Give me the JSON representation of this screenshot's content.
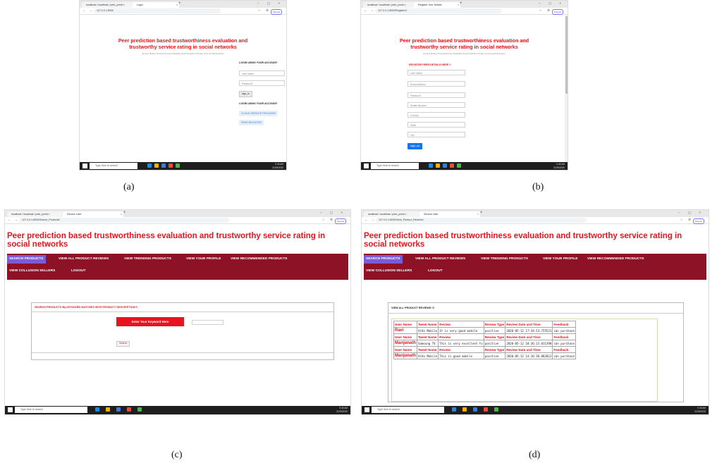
{
  "captions": {
    "a": "(a)",
    "b": "(b)",
    "c": "(c)",
    "d": "(d)"
  },
  "chrome": {
    "tab_localhost": "localhost / localhost / peer_predi ×",
    "tab_login": "Login",
    "tab_register": "Register Your Details",
    "tab_service_user": "Service User",
    "new_tab": "+",
    "window_controls": "– ▢ ×",
    "nav_buttons": "← → C",
    "url_a": "127.0.0.1:8000",
    "url_b": "127.0.0.1:8000/Register1/",
    "url_c": "127.0.0.1:8000/Search_Products/",
    "url_d": "127.0.0.1:8000/View_Product_Reviews/",
    "paused": "Paused"
  },
  "taskbar": {
    "search_placeholder": "Type here to search",
    "time": "9:45 AM",
    "date": "21/05/2020",
    "lang": "ENG IN"
  },
  "app": {
    "title": "Peer prediction based trustworthiness evaluation and trustworthy service rating in social networks",
    "subtitle": "Service Rating Trustworthiness Reliability Peer Prediction Private Trust Social Networks"
  },
  "login": {
    "heading_user": "LOGIN USING YOUR ACCOUNT:",
    "username_placeholder": "User Name",
    "password_placeholder": "Password",
    "signin": "sign_in",
    "heading_other": "LOGIN USING YOUR ACCOUNT:",
    "cloud_button": "CLOUD SERVICE PROVIDER",
    "peer_button": "PEER REGISTER"
  },
  "register": {
    "heading": "REGISTER PEER DETAILS HERE !!",
    "fields": [
      "User Name",
      "Email Address",
      "Password",
      "Mobile Number",
      "Country",
      "State",
      "City"
    ],
    "signup": "sign_up"
  },
  "menu": {
    "items": [
      "SEARCH PRODUCTS",
      "VIEW ALL PRODUCT REVIEWS",
      "VIEW TRENDING PRODUCTS",
      "VIEW YOUR PROFILE",
      "VIEW RECOMMENDED PRODUCTS"
    ],
    "row2": [
      "VIEW COLLUSION SELLERS",
      "LOGOUT"
    ]
  },
  "search": {
    "heading": "SEARCH PRODUCTS By KEYWORD MATCHES WITH PRODUCT DESCRIPTION!!!",
    "keyword_label": "Enter Your Keyword Here",
    "button": "Search"
  },
  "reviews": {
    "heading": "VIEW ALL PRODUCT REVIEWS !!!",
    "headers": [
      "User Name",
      "Tweet Name",
      "Review",
      "Review Type",
      "Review Date and Time",
      "Feedback"
    ],
    "rows": [
      {
        "user": "Ravi",
        "tweet": "ViVo Mobile",
        "review": "It is very good mobile",
        "type": "positive",
        "datetime": "2020-05-12 17:34:53.755531",
        "feedback": "can purchase"
      },
      {
        "user": "Manjunath",
        "tweet": "Samsung TV",
        "review": "This is very excellent tv",
        "type": "positive",
        "datetime": "2020-05-12 18:36:23.011390",
        "feedback": "can purchase"
      },
      {
        "user": "Manjunath",
        "tweet": "ViVo Mobile",
        "review": "This is good mobile",
        "type": "positive",
        "datetime": "2020-05-12 14:16:20.882012",
        "feedback": "can purchase"
      }
    ]
  }
}
